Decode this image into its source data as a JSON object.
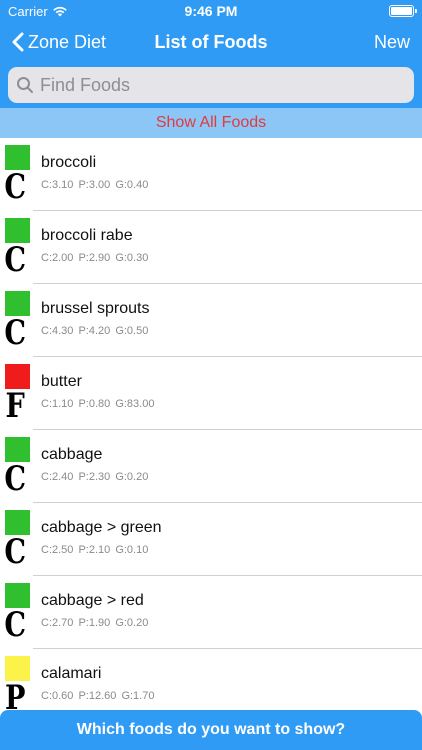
{
  "status": {
    "carrier": "Carrier",
    "time": "9:46 PM"
  },
  "nav": {
    "back_label": "Zone Diet",
    "title": "List of Foods",
    "new_label": "New"
  },
  "search": {
    "placeholder": "Find Foods"
  },
  "show_all_label": "Show All Foods",
  "foods": [
    {
      "name": "broccoli",
      "letter": "C",
      "color": "#2fbf2f",
      "nutrition": "C:3.10  P:3.00  G:0.40"
    },
    {
      "name": "broccoli rabe",
      "letter": "C",
      "color": "#2fbf2f",
      "nutrition": "C:2.00  P:2.90  G:0.30"
    },
    {
      "name": "brussel sprouts",
      "letter": "C",
      "color": "#2fbf2f",
      "nutrition": "C:4.30  P:4.20  G:0.50"
    },
    {
      "name": "butter",
      "letter": "F",
      "color": "#f01b1b",
      "nutrition": "C:1.10  P:0.80  G:83.00"
    },
    {
      "name": "cabbage",
      "letter": "C",
      "color": "#2fbf2f",
      "nutrition": "C:2.40  P:2.30  G:0.20"
    },
    {
      "name": "cabbage > green",
      "letter": "C",
      "color": "#2fbf2f",
      "nutrition": "C:2.50  P:2.10  G:0.10"
    },
    {
      "name": "cabbage > red",
      "letter": "C",
      "color": "#2fbf2f",
      "nutrition": "C:2.70  P:1.90  G:0.20"
    },
    {
      "name": "calamari",
      "letter": "P",
      "color": "#fbf24a",
      "nutrition": "C:0.60  P:12.60  G:1.70"
    }
  ],
  "bottom_label": "Which foods do you want to show?",
  "colors": {
    "accent": "#2f9bf5",
    "show_all_bg": "#8cc6f7",
    "show_all_text": "#e23b3b"
  },
  "icons": {
    "back": "chevron-left-icon",
    "search": "search-icon",
    "wifi": "wifi-icon",
    "battery": "battery-icon"
  }
}
